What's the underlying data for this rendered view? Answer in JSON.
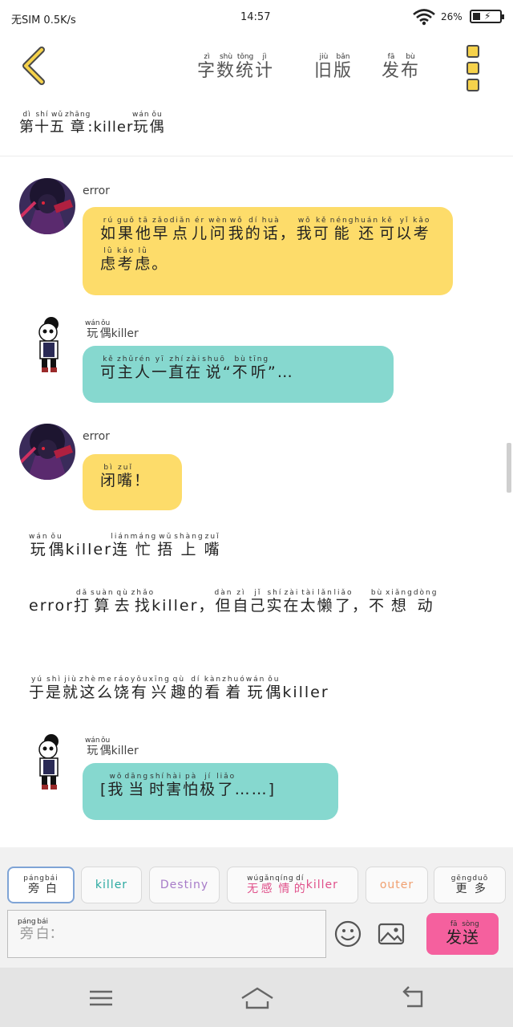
{
  "status_bar": {
    "carrier": "无SIM 0.5K/s",
    "time": "14:57",
    "battery_percent": "26%"
  },
  "header": {
    "word_count": {
      "text": "字数统计",
      "pinyin": [
        "zì",
        "shù",
        "tǒng",
        "jì"
      ]
    },
    "old_version": {
      "text": "旧版",
      "pinyin": [
        "jiù",
        "bǎn"
      ]
    },
    "publish": {
      "text": "发布",
      "pinyin": [
        "fā",
        "bù"
      ]
    }
  },
  "chapter_title": "第十五章:killer玩偶",
  "messages": [
    {
      "speaker": "error",
      "text": "如果他早点儿问我的话，我可能还可以考虑考虑。"
    },
    {
      "speaker": "玩偶killer",
      "text": "可主人一直在说“不听”…"
    },
    {
      "speaker": "error",
      "text": "闭嘴！"
    },
    {
      "narration": "玩偶killer连忙捂上嘴"
    },
    {
      "narration": "error打算去找killer，但自己实在太懒了，不想动"
    },
    {
      "narration": "于是就这么饶有兴趣的看着玩偶killer"
    },
    {
      "speaker": "玩偶killer",
      "text": "[我当时害怕极了……]"
    }
  ],
  "colors": {
    "error_bubble": "#fddc6a",
    "killer_bubble": "#86d8cf",
    "send_button": "#f5609e"
  },
  "roles": [
    {
      "label": "旁白",
      "color": "#333333"
    },
    {
      "label": "killer",
      "color": "#2aa9a0"
    },
    {
      "label": "Destiny",
      "color": "#a77bc8"
    },
    {
      "label": "无感情的killer",
      "color": "#e0508a"
    },
    {
      "label": "outer",
      "color": "#f0a070"
    },
    {
      "label": "更多",
      "color": "#333333"
    }
  ],
  "input": {
    "placeholder": "旁白："
  },
  "send_label": "发送"
}
